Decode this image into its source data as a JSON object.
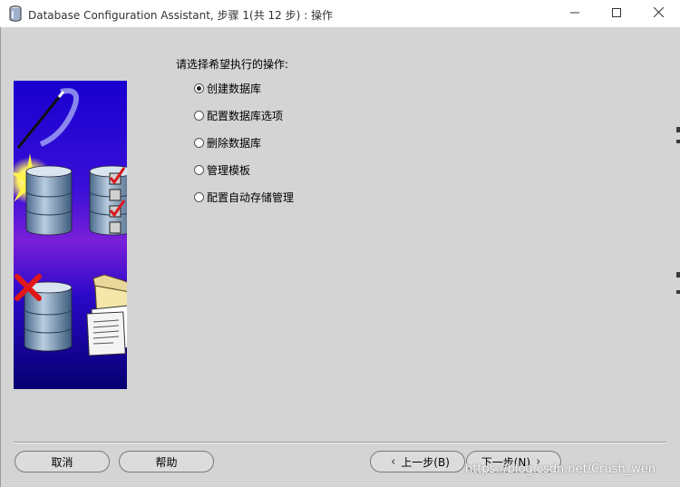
{
  "window": {
    "title": "Database Configuration Assistant, 步骤 1(共 12 步) : 操作"
  },
  "main": {
    "prompt": "请选择希望执行的操作:",
    "options": [
      {
        "label": "创建数据库",
        "checked": true
      },
      {
        "label": "配置数据库选项",
        "checked": false
      },
      {
        "label": "删除数据库",
        "checked": false
      },
      {
        "label": "管理模板",
        "checked": false
      },
      {
        "label": "配置自动存储管理",
        "checked": false
      }
    ]
  },
  "buttons": {
    "cancel": "取消",
    "help": "帮助",
    "back": "上一步(B)",
    "next": "下一步(N)"
  },
  "watermark": "https://blog.csdn.net/Crush_wen",
  "icons": {
    "app": "database-icon",
    "minimize": "minimize-icon",
    "maximize": "maximize-icon",
    "close": "close-icon"
  },
  "colors": {
    "dialog_bg": "#d4d4d4",
    "art_bg_top": "#1400c8",
    "art_bg_mid": "#7a1fd6",
    "check_red": "#d81820"
  }
}
